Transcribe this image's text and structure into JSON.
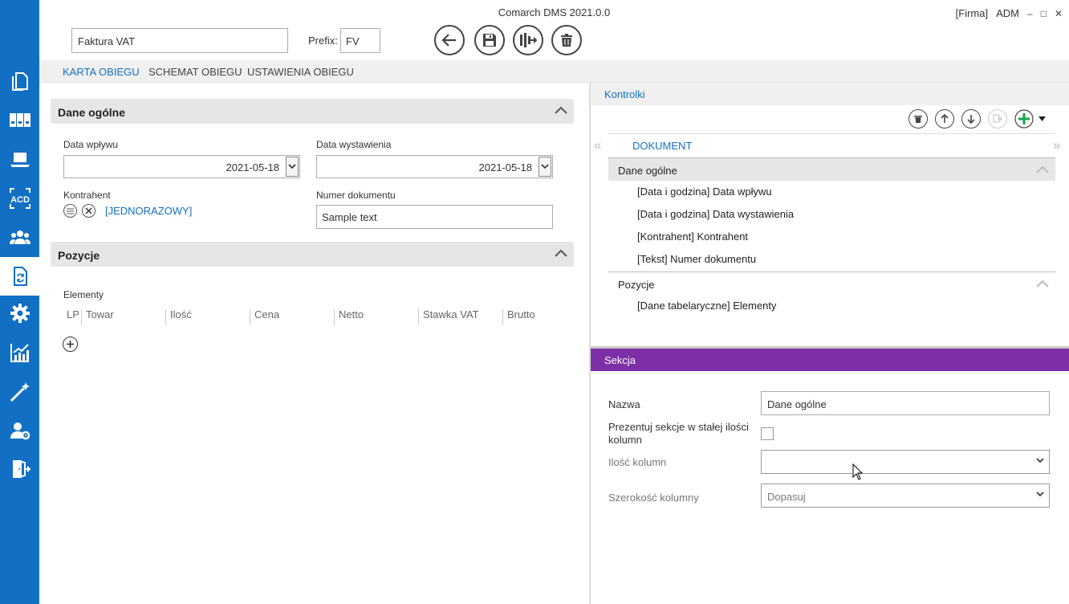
{
  "window": {
    "title": "Comarch DMS 2021.0.0",
    "company": "[Firma]",
    "user": "ADM",
    "minimize": "–",
    "maximize": "□",
    "close": "✕"
  },
  "sidebar": {
    "items": [
      {
        "icon": "documents-icon"
      },
      {
        "icon": "binders-icon"
      },
      {
        "icon": "laptop-icon"
      },
      {
        "icon": "acd-icon",
        "label": "ACD"
      },
      {
        "icon": "users-icon"
      },
      {
        "icon": "workflow-document-icon",
        "active": true
      },
      {
        "icon": "gear-icon"
      },
      {
        "icon": "reports-chart-icon"
      },
      {
        "icon": "magic-wand-icon"
      },
      {
        "icon": "user-settings-icon"
      },
      {
        "icon": "logout-icon"
      }
    ]
  },
  "header": {
    "document_type_name": "Faktura VAT",
    "prefix_label": "Prefix:",
    "prefix_value": "FV"
  },
  "tabs": [
    {
      "label": "KARTA OBIEGU",
      "active": true
    },
    {
      "label": "SCHEMAT OBIEGU"
    },
    {
      "label": "USTAWIENIA OBIEGU"
    }
  ],
  "form": {
    "general_section": {
      "title": "Dane ogólne",
      "receipt_date_label": "Data wpływu",
      "receipt_date_value": "2021-05-18",
      "issue_date_label": "Data wystawienia",
      "issue_date_value": "2021-05-18",
      "contractor_label": "Kontrahent",
      "contractor_value": "[JEDNORAZOWY]",
      "doc_number_label": "Numer dokumentu",
      "doc_number_value": "Sample text"
    },
    "positions_section": {
      "title": "Pozycje",
      "elements_label": "Elementy",
      "columns": [
        "LP",
        "Towar",
        "Ilość",
        "Cena",
        "Netto",
        "Stawka VAT",
        "Brutto"
      ]
    }
  },
  "controls_panel": {
    "title": "Kontrolki",
    "document_tab": "DOKUMENT",
    "sections": [
      {
        "title": "Dane ogólne",
        "selected": true,
        "items": [
          "[Data i godzina] Data wpływu",
          "[Data i godzina] Data wystawienia",
          "[Kontrahent] Kontrahent",
          "[Tekst] Numer dokumentu"
        ]
      },
      {
        "title": "Pozycje",
        "items": [
          "[Dane tabelaryczne] Elementy"
        ]
      }
    ]
  },
  "section_props": {
    "title": "Sekcja",
    "name_label": "Nazwa",
    "name_value": "Dane ogólne",
    "fixed_columns_label": "Prezentuj sekcje w stałej ilości kolumn",
    "column_count_label": "Ilość kolumn",
    "column_count_value": "",
    "column_width_label": "Szerokość kolumny",
    "column_width_value": "Dopasuj"
  },
  "colors": {
    "accent": "#1170c4",
    "section_header": "#7d2fa8",
    "add_green": "#1aa34a"
  }
}
